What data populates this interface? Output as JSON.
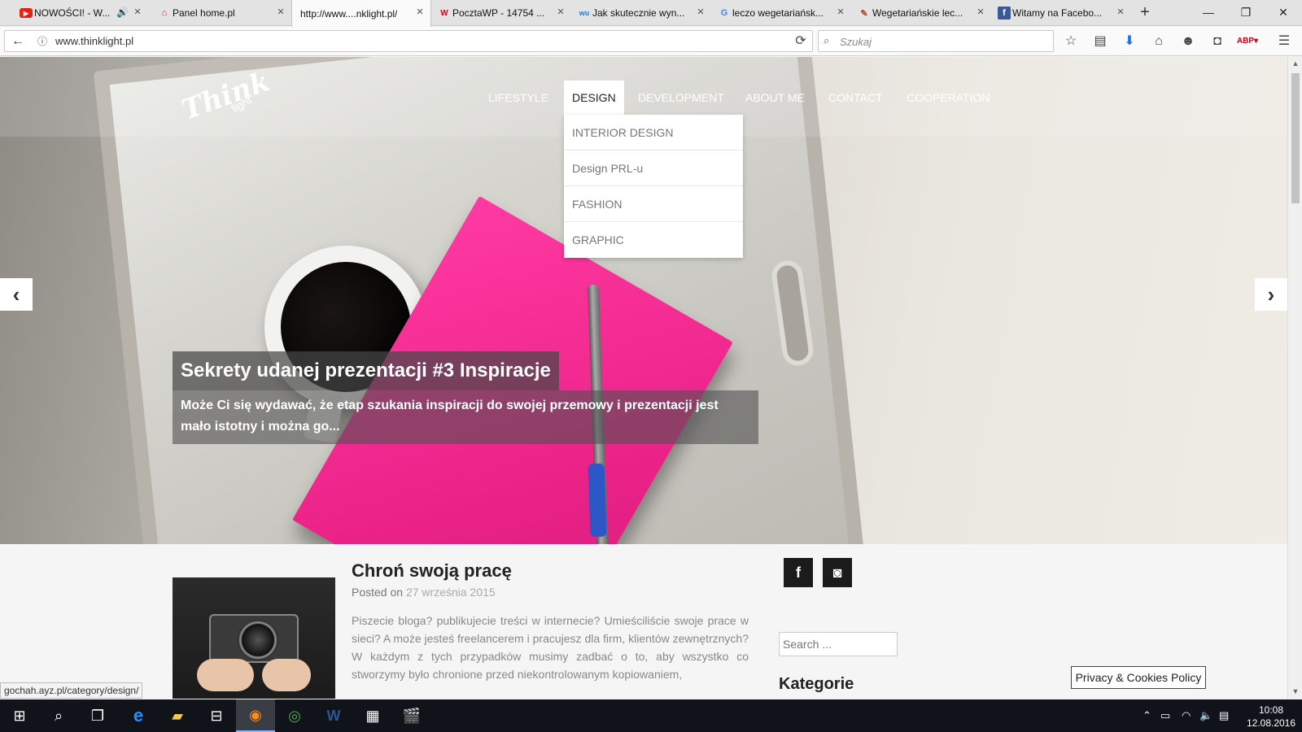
{
  "browser": {
    "tabs": [
      {
        "label": "NOWOŚCI! - W...",
        "favicon": "youtube-icon",
        "color": "#e62117"
      },
      {
        "label": "Panel home.pl",
        "favicon": "home-pl-icon",
        "color": "#d5242a"
      },
      {
        "label": "http://www....nklight.pl/",
        "favicon": "",
        "color": "#666666"
      },
      {
        "label": "PocztaWP - 14754 ...",
        "favicon": "wp-icon",
        "color": "#d0021b"
      },
      {
        "label": "Jak skutecznie wyn...",
        "favicon": "wu-icon",
        "color": "#2a76c6"
      },
      {
        "label": "leczo wegetariańsk...",
        "favicon": "google-icon",
        "color": "#4285f4"
      },
      {
        "label": "Wegetariańskie lec...",
        "favicon": "carrot-icon",
        "color": "#b0462a"
      },
      {
        "label": "Witamy na Facebo...",
        "favicon": "facebook-icon",
        "color": "#3b5998"
      }
    ],
    "url": "www.thinklight.pl",
    "search_placeholder": "Szukaj",
    "status_url": "gochah.ayz.pl/category/design/"
  },
  "site": {
    "logo_main": "Think",
    "logo_sub": "light",
    "nav": [
      {
        "label": "LIFESTYLE",
        "active": false
      },
      {
        "label": "DESIGN",
        "active": true
      },
      {
        "label": "DEVELOPMENT",
        "active": false
      },
      {
        "label": "ABOUT ME",
        "active": false
      },
      {
        "label": "CONTACT",
        "active": false
      },
      {
        "label": "COOPERATION",
        "active": false
      }
    ],
    "dropdown": [
      "INTERIOR DESIGN",
      "Design PRL-u",
      "FASHION",
      "GRAPHIC"
    ],
    "slider": {
      "title": "Sekrety udanej prezentacji #3 Inspiracje",
      "text": "Może Ci się wydawać, że etap szukania inspiracji do swojej przemowy i prezentacji jest mało istotny i można go...",
      "prev": "‹",
      "next": "›"
    },
    "post": {
      "title": "Chroń swoją pracę",
      "meta_prefix": "Posted on",
      "date": "27 września 2015",
      "excerpt": "Piszecie bloga? publikujecie treści w internecie? Umieściliście swoje prace w sieci? A może jesteś freelancerem i pracujesz dla firm, klientów zewnętrznych? W każdym z tych przypadków musimy zadbać o to, aby wszystko co stworzymy było chronione przed niekontrolowanym kopiowaniem,"
    },
    "sidebar": {
      "social": [
        {
          "icon": "facebook-icon",
          "glyph": "f"
        },
        {
          "icon": "instagram-icon",
          "glyph": "◙"
        }
      ],
      "search_placeholder": "Search ...",
      "heading": "Kategorie"
    },
    "privacy_button": "Privacy & Cookies Policy"
  },
  "taskbar": {
    "time": "10:08",
    "date": "12.08.2016"
  }
}
